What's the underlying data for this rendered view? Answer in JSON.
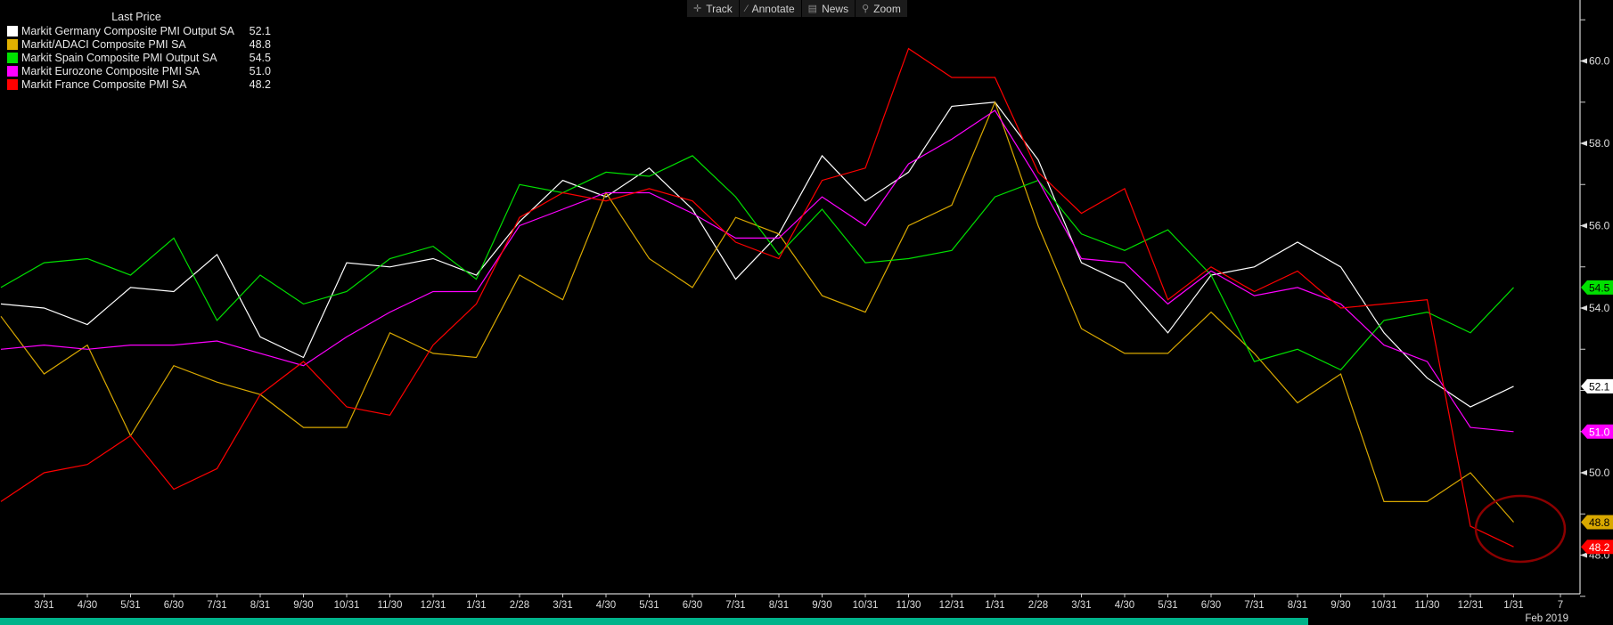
{
  "toolbar": {
    "items": [
      {
        "label": "Track",
        "icon": "crosshair-icon"
      },
      {
        "label": "Annotate",
        "icon": "pencil-icon"
      },
      {
        "label": "News",
        "icon": "news-icon"
      },
      {
        "label": "Zoom",
        "icon": "magnifier-icon"
      }
    ]
  },
  "legend": {
    "header": "Last Price",
    "items": [
      {
        "name": "Markit Germany Composite PMI Output SA",
        "value": "52.1",
        "color": "#ffffff"
      },
      {
        "name": "Markit/ADACI Composite PMI SA",
        "value": "48.8",
        "color": "#e0b000"
      },
      {
        "name": "Markit Spain Composite PMI Output SA",
        "value": "54.5",
        "color": "#00e000"
      },
      {
        "name": "Markit Eurozone Composite PMI SA",
        "value": "51.0",
        "color": "#ff00ff"
      },
      {
        "name": "Markit France Composite PMI SA",
        "value": "48.2",
        "color": "#ff0000"
      }
    ]
  },
  "chart_data": {
    "type": "line",
    "title": "",
    "x": [
      "2016-02",
      "2016-03",
      "2016-04",
      "2016-05",
      "2016-06",
      "2016-07",
      "2016-08",
      "2016-09",
      "2016-10",
      "2016-11",
      "2016-12",
      "2017-01",
      "2017-02",
      "2017-03",
      "2017-04",
      "2017-05",
      "2017-06",
      "2017-07",
      "2017-08",
      "2017-09",
      "2017-10",
      "2017-11",
      "2017-12",
      "2018-01",
      "2018-02",
      "2018-03",
      "2018-04",
      "2018-05",
      "2018-06",
      "2018-07",
      "2018-08",
      "2018-09",
      "2018-10",
      "2018-11",
      "2018-12",
      "2019-01"
    ],
    "x_tick_labels": [
      "3/31",
      "4/30",
      "5/31",
      "6/30",
      "7/31",
      "8/31",
      "9/30",
      "10/31",
      "11/30",
      "12/31",
      "1/31",
      "2/28",
      "3/31",
      "4/30",
      "5/31",
      "6/30",
      "7/31",
      "8/31",
      "9/30",
      "10/31",
      "11/30",
      "12/31",
      "1/31",
      "2/28",
      "3/31",
      "4/30",
      "5/31",
      "6/30",
      "7/31",
      "8/31",
      "9/30",
      "10/31",
      "11/30",
      "12/31",
      "1/31",
      "7"
    ],
    "x_sublabel": "Feb 2019",
    "y_ticks": [
      "60.0",
      "58.0",
      "56.0",
      "54.0",
      "50.0",
      "48.0"
    ],
    "ylim": [
      46.8,
      61.5
    ],
    "y_axis_side": "right",
    "legend_position": "top-left",
    "series": [
      {
        "name": "Markit Germany Composite PMI Output SA",
        "color": "#ffffff",
        "last": "52.1",
        "badge_text": "#000000",
        "values": [
          54.1,
          54.0,
          53.6,
          54.5,
          54.4,
          55.3,
          53.3,
          52.8,
          55.1,
          55.0,
          55.2,
          54.8,
          56.1,
          57.1,
          56.7,
          57.4,
          56.4,
          54.7,
          55.8,
          57.7,
          56.6,
          57.3,
          58.9,
          59.0,
          57.6,
          55.1,
          54.6,
          53.4,
          54.8,
          55.0,
          55.6,
          55.0,
          53.4,
          52.3,
          51.6,
          52.1
        ]
      },
      {
        "name": "Markit/ADACI Composite PMI SA",
        "color": "#d9a800",
        "last": "48.8",
        "badge_text": "#000000",
        "values": [
          53.8,
          52.4,
          53.1,
          50.9,
          52.6,
          52.2,
          51.9,
          51.1,
          51.1,
          53.4,
          52.9,
          52.8,
          54.8,
          54.2,
          56.8,
          55.2,
          54.5,
          56.2,
          55.8,
          54.3,
          53.9,
          56.0,
          56.5,
          59.0,
          56.0,
          53.5,
          52.9,
          52.9,
          53.9,
          52.9,
          51.7,
          52.4,
          49.3,
          49.3,
          50.0,
          48.8
        ]
      },
      {
        "name": "Markit Spain Composite PMI Output SA",
        "color": "#00e000",
        "last": "54.5",
        "badge_text": "#000000",
        "values": [
          54.5,
          55.1,
          55.2,
          54.8,
          55.7,
          53.7,
          54.8,
          54.1,
          54.4,
          55.2,
          55.5,
          54.7,
          57.0,
          56.8,
          57.3,
          57.2,
          57.7,
          56.7,
          55.3,
          56.4,
          55.1,
          55.2,
          55.4,
          56.7,
          57.1,
          55.8,
          55.4,
          55.9,
          54.8,
          52.7,
          53.0,
          52.5,
          53.7,
          53.9,
          53.4,
          54.5
        ]
      },
      {
        "name": "Markit Eurozone Composite PMI SA",
        "color": "#ff00ff",
        "last": "51.0",
        "badge_text": "#ffffff",
        "values": [
          53.0,
          53.1,
          53.0,
          53.1,
          53.1,
          53.2,
          52.9,
          52.6,
          53.3,
          53.9,
          54.4,
          54.4,
          56.0,
          56.4,
          56.8,
          56.8,
          56.3,
          55.7,
          55.7,
          56.7,
          56.0,
          57.5,
          58.1,
          58.8,
          57.1,
          55.2,
          55.1,
          54.1,
          54.9,
          54.3,
          54.5,
          54.1,
          53.1,
          52.7,
          51.1,
          51.0
        ]
      },
      {
        "name": "Markit France Composite PMI SA",
        "color": "#ff0000",
        "last": "48.2",
        "badge_text": "#ffffff",
        "values": [
          49.3,
          50.0,
          50.2,
          50.9,
          49.6,
          50.1,
          51.9,
          52.7,
          51.6,
          51.4,
          53.1,
          54.1,
          56.2,
          56.8,
          56.6,
          56.9,
          56.6,
          55.6,
          55.2,
          57.1,
          57.4,
          60.3,
          59.6,
          59.6,
          57.3,
          56.3,
          56.9,
          54.2,
          55.0,
          54.4,
          54.9,
          54.0,
          54.1,
          54.2,
          48.7,
          48.2
        ]
      }
    ],
    "annotation": {
      "type": "ellipse",
      "color": "#8b0000",
      "around": "2018-12 to 2019-01, 48.2-48.8"
    }
  }
}
